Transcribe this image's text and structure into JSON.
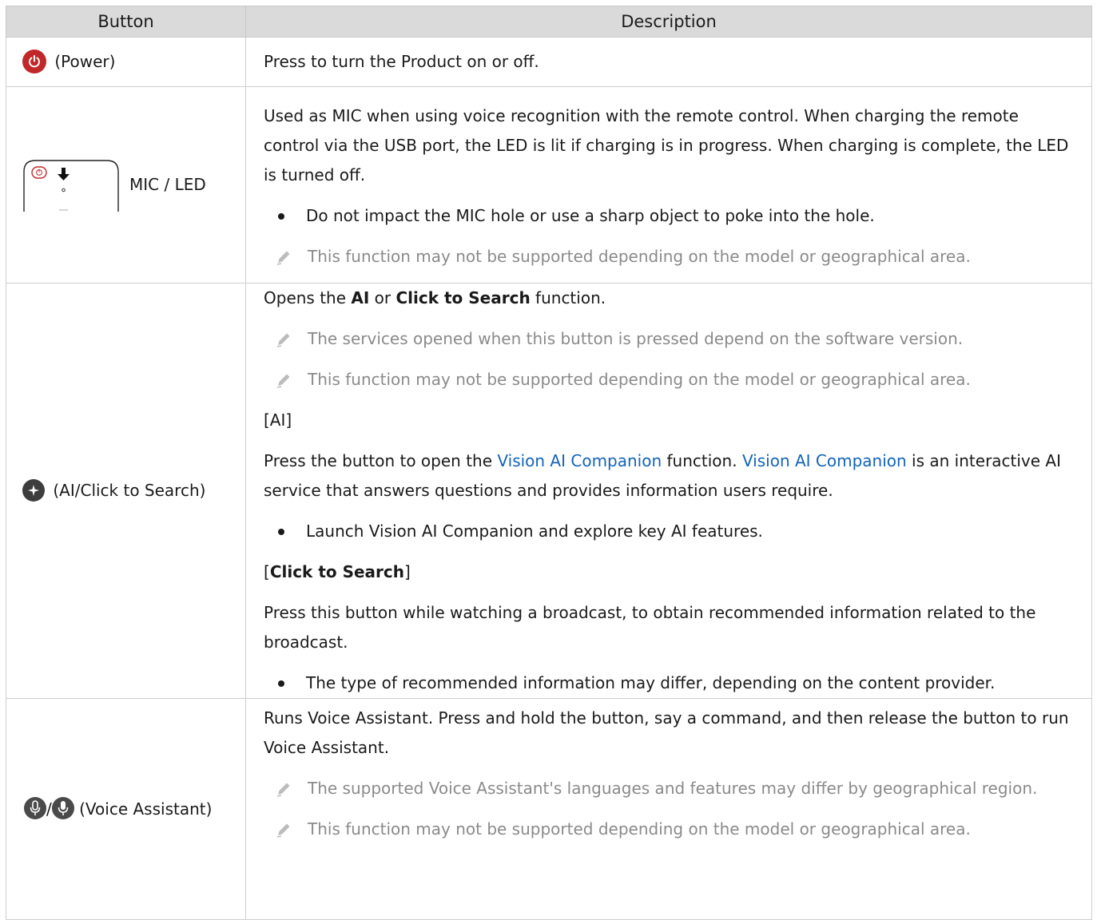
{
  "header": {
    "col_button": "Button",
    "col_description": "Description"
  },
  "rows": {
    "power": {
      "button_label": "(Power)",
      "icon": "power-icon",
      "icon_color": "#c0282a",
      "desc": "Press to turn the Product on or off."
    },
    "mic": {
      "button_label": "MIC / LED",
      "icon": "remote-mic-led-illustration",
      "desc": "Used as MIC when using voice recognition with the remote control. When charging the remote control via the USB port, the LED is lit if charging is in progress. When charging is complete, the LED is turned off.",
      "bullet": "Do not impact the MIC hole or use a sharp object to poke into the hole.",
      "note": "This function may not be supported depending on the model or geographical area."
    },
    "ai": {
      "button_label": "(AI/Click to Search)",
      "icon": "ai-icon",
      "intro_pre": "Opens the ",
      "intro_ai": "AI",
      "intro_or": " or ",
      "intro_cts": "Click to Search",
      "intro_post": " function.",
      "note1": "The services opened when this button is pressed depend on the software version.",
      "note2": "This function may not be supported depending on the model or geographical area.",
      "ai_heading": "[AI]",
      "ai_desc_pre": "Press the button to open the ",
      "ai_link1": "Vision AI Companion",
      "ai_desc_mid": " function. ",
      "ai_link2": "Vision AI Companion",
      "ai_desc_post": " is an interactive AI service that answers questions and provides information users require.",
      "ai_bullet": "Launch Vision AI Companion and explore key AI features.",
      "cts_open": "[",
      "cts_heading": "Click to Search",
      "cts_close": "]",
      "cts_desc": "Press this button while watching a broadcast, to obtain recommended information related to the broadcast.",
      "cts_bullet": "The type of recommended information may differ, depending on the content provider."
    },
    "va": {
      "slash": "/",
      "button_label": "(Voice Assistant)",
      "icon": "mic-icon",
      "desc": "Runs Voice Assistant. Press and hold the button, say a command, and then release the button to run Voice Assistant.",
      "note1": "The supported Voice Assistant's languages and features may differ by geographical region.",
      "note2": "This function may not be supported depending on the model or geographical area."
    }
  },
  "colors": {
    "header_bg": "#dadada",
    "link": "#1463b8",
    "note_text": "#8a8a8a"
  }
}
